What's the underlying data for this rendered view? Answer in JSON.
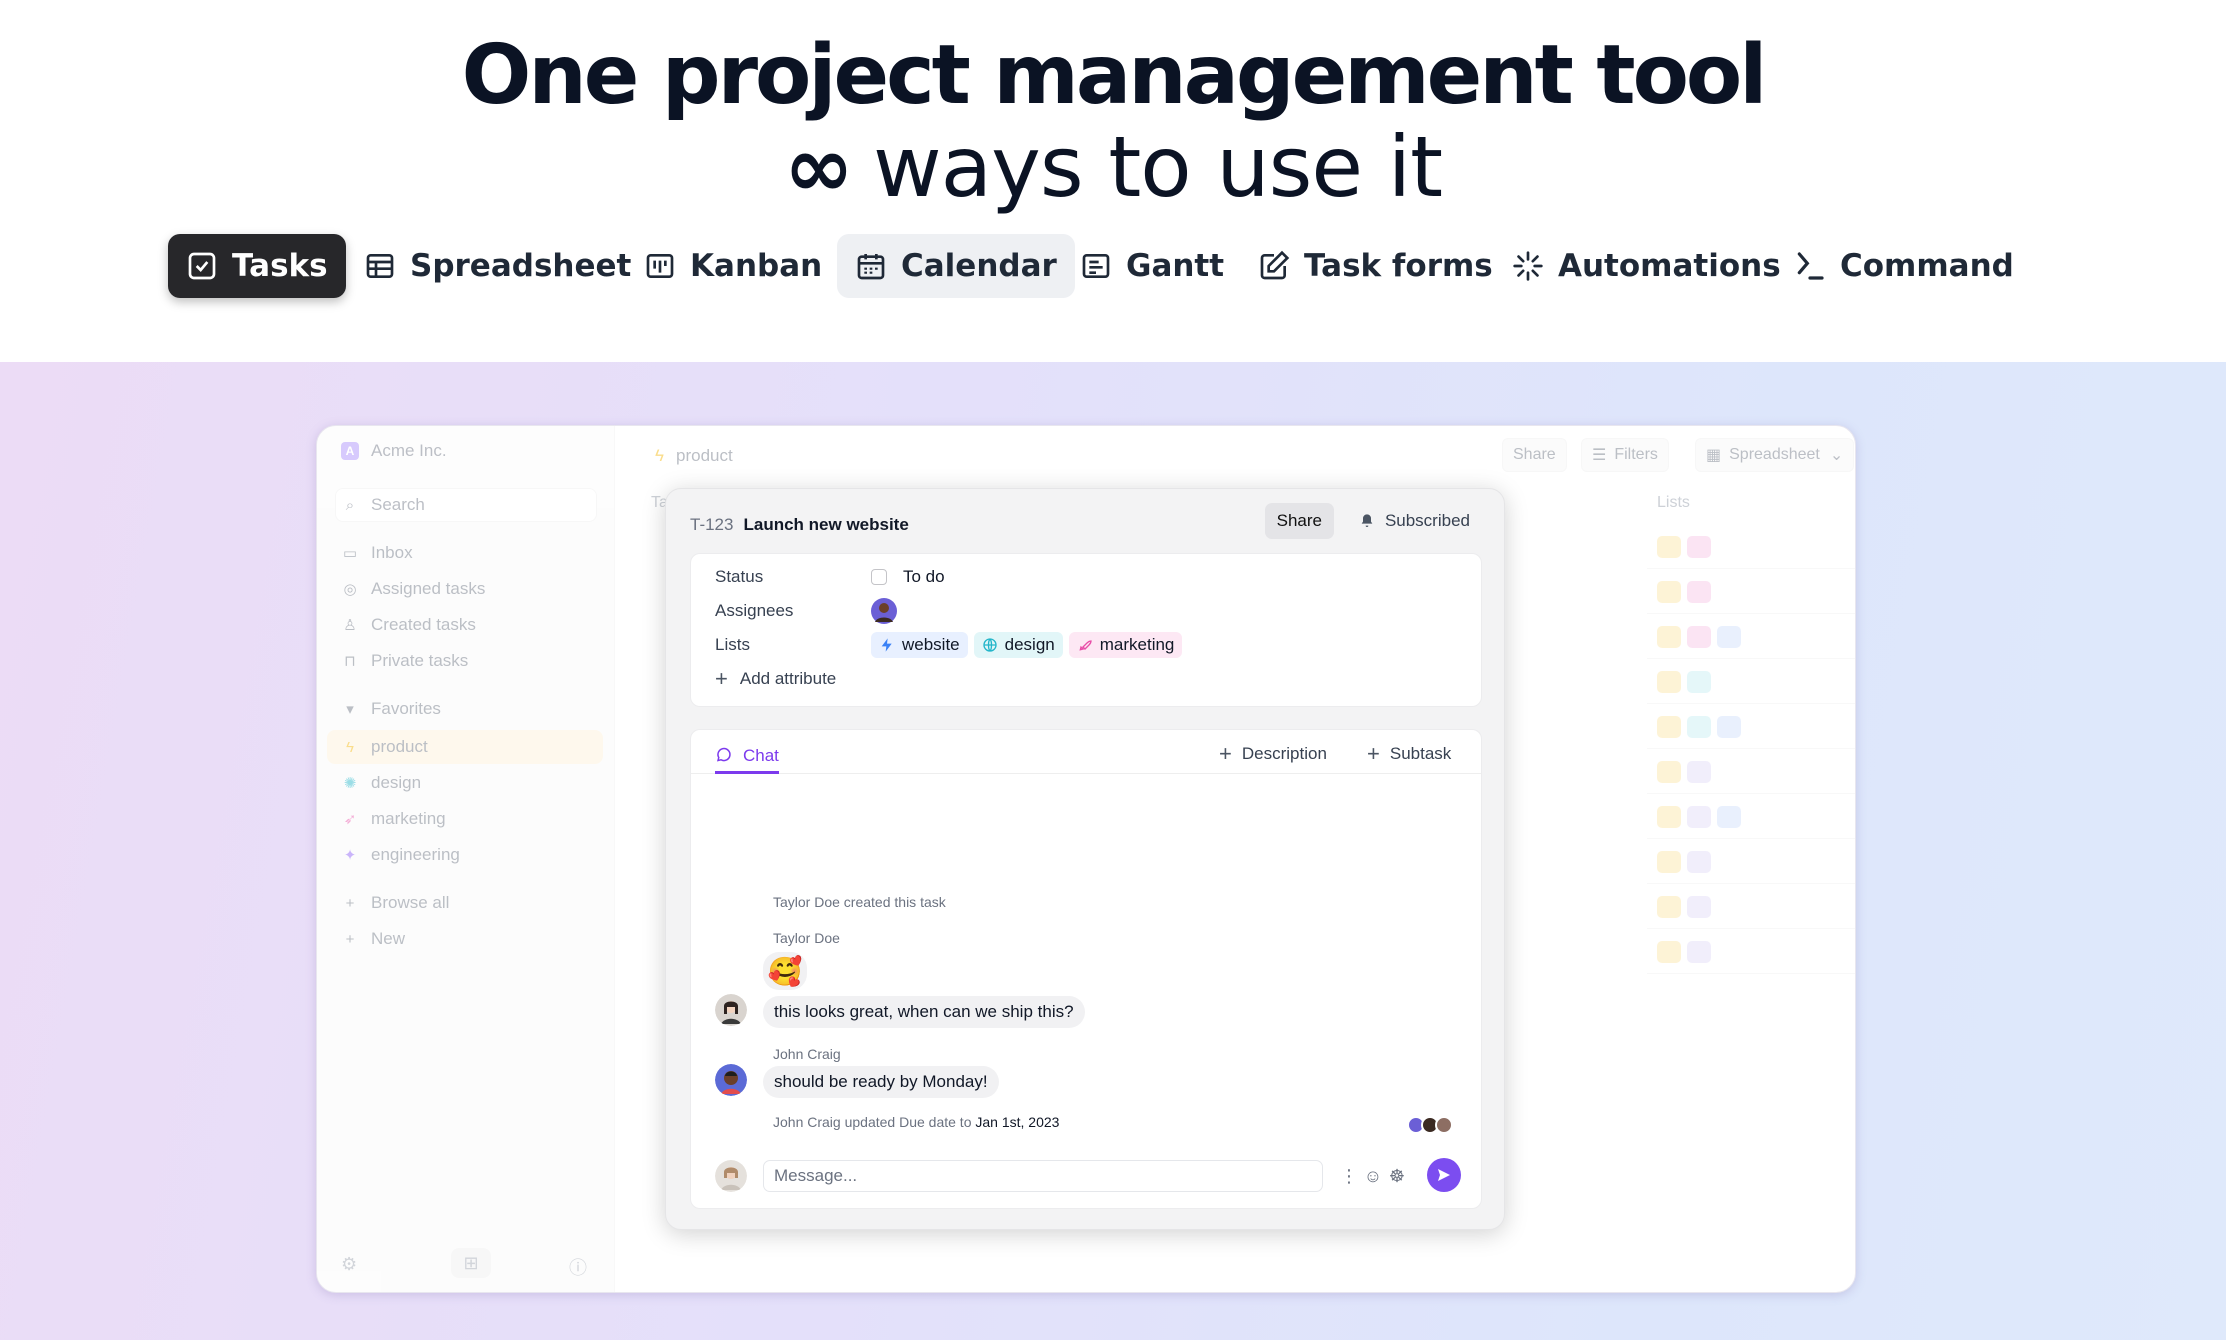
{
  "hero": {
    "title": "One project management tool",
    "subtitle_symbol": "∞",
    "subtitle": "ways to use it"
  },
  "tabs": [
    {
      "label": "Tasks",
      "icon": "check-square-icon",
      "state": "active"
    },
    {
      "label": "Spreadsheet",
      "icon": "table-icon",
      "state": "normal"
    },
    {
      "label": "Kanban",
      "icon": "kanban-icon",
      "state": "normal"
    },
    {
      "label": "Calendar",
      "icon": "calendar-icon",
      "state": "hover"
    },
    {
      "label": "Gantt",
      "icon": "gantt-icon",
      "state": "normal"
    },
    {
      "label": "Task forms",
      "icon": "form-edit-icon",
      "state": "normal"
    },
    {
      "label": "Automations",
      "icon": "sparkle-icon",
      "state": "normal"
    },
    {
      "label": "Command",
      "icon": "command-icon",
      "state": "normal"
    }
  ],
  "app": {
    "workspace": "Acme Inc.",
    "workspace_initial": "A",
    "search_placeholder": "Search",
    "nav": [
      "Inbox",
      "Assigned tasks",
      "Created tasks",
      "Private tasks"
    ],
    "favorites_label": "Favorites",
    "favorites": [
      "product",
      "design",
      "marketing",
      "engineering"
    ],
    "browse_all": "Browse all",
    "new_label": "New",
    "breadcrumb": "product",
    "toolbar": {
      "share": "Share",
      "filters": "Filters",
      "view": "Spreadsheet"
    },
    "bg_col_lists": "Lists",
    "bg_col_first": "Ta"
  },
  "task": {
    "id": "T-123",
    "title": "Launch new website",
    "share": "Share",
    "subscribed": "Subscribed",
    "attributes": {
      "status_label": "Status",
      "status_value": "To do",
      "assignees_label": "Assignees",
      "lists_label": "Lists",
      "lists": [
        {
          "name": "website",
          "color": "#e8f0ff",
          "icon": "bolt-icon",
          "icon_color": "#3b82f6"
        },
        {
          "name": "design",
          "color": "#e2f6f8",
          "icon": "globe-icon",
          "icon_color": "#22b5c9"
        },
        {
          "name": "marketing",
          "color": "#fde8f4",
          "icon": "rocket-icon",
          "icon_color": "#e84fa8"
        }
      ],
      "add_attribute": "Add attribute"
    },
    "chat": {
      "tab": "Chat",
      "description_btn": "Description",
      "subtask_btn": "Subtask",
      "created_event": "Taylor Doe created this task",
      "author1": "Taylor Doe",
      "emoji": "🥰",
      "message1": "this looks great, when can we ship this?",
      "author2": "John Craig",
      "message2": "should be ready by Monday!",
      "update_event": "John Craig updated Due date to",
      "update_value": "Jan 1st, 2023",
      "input_placeholder": "Message..."
    }
  },
  "colors": {
    "accent": "#7c3aed",
    "send": "#7c4df0",
    "active_tab": "#27272a"
  }
}
